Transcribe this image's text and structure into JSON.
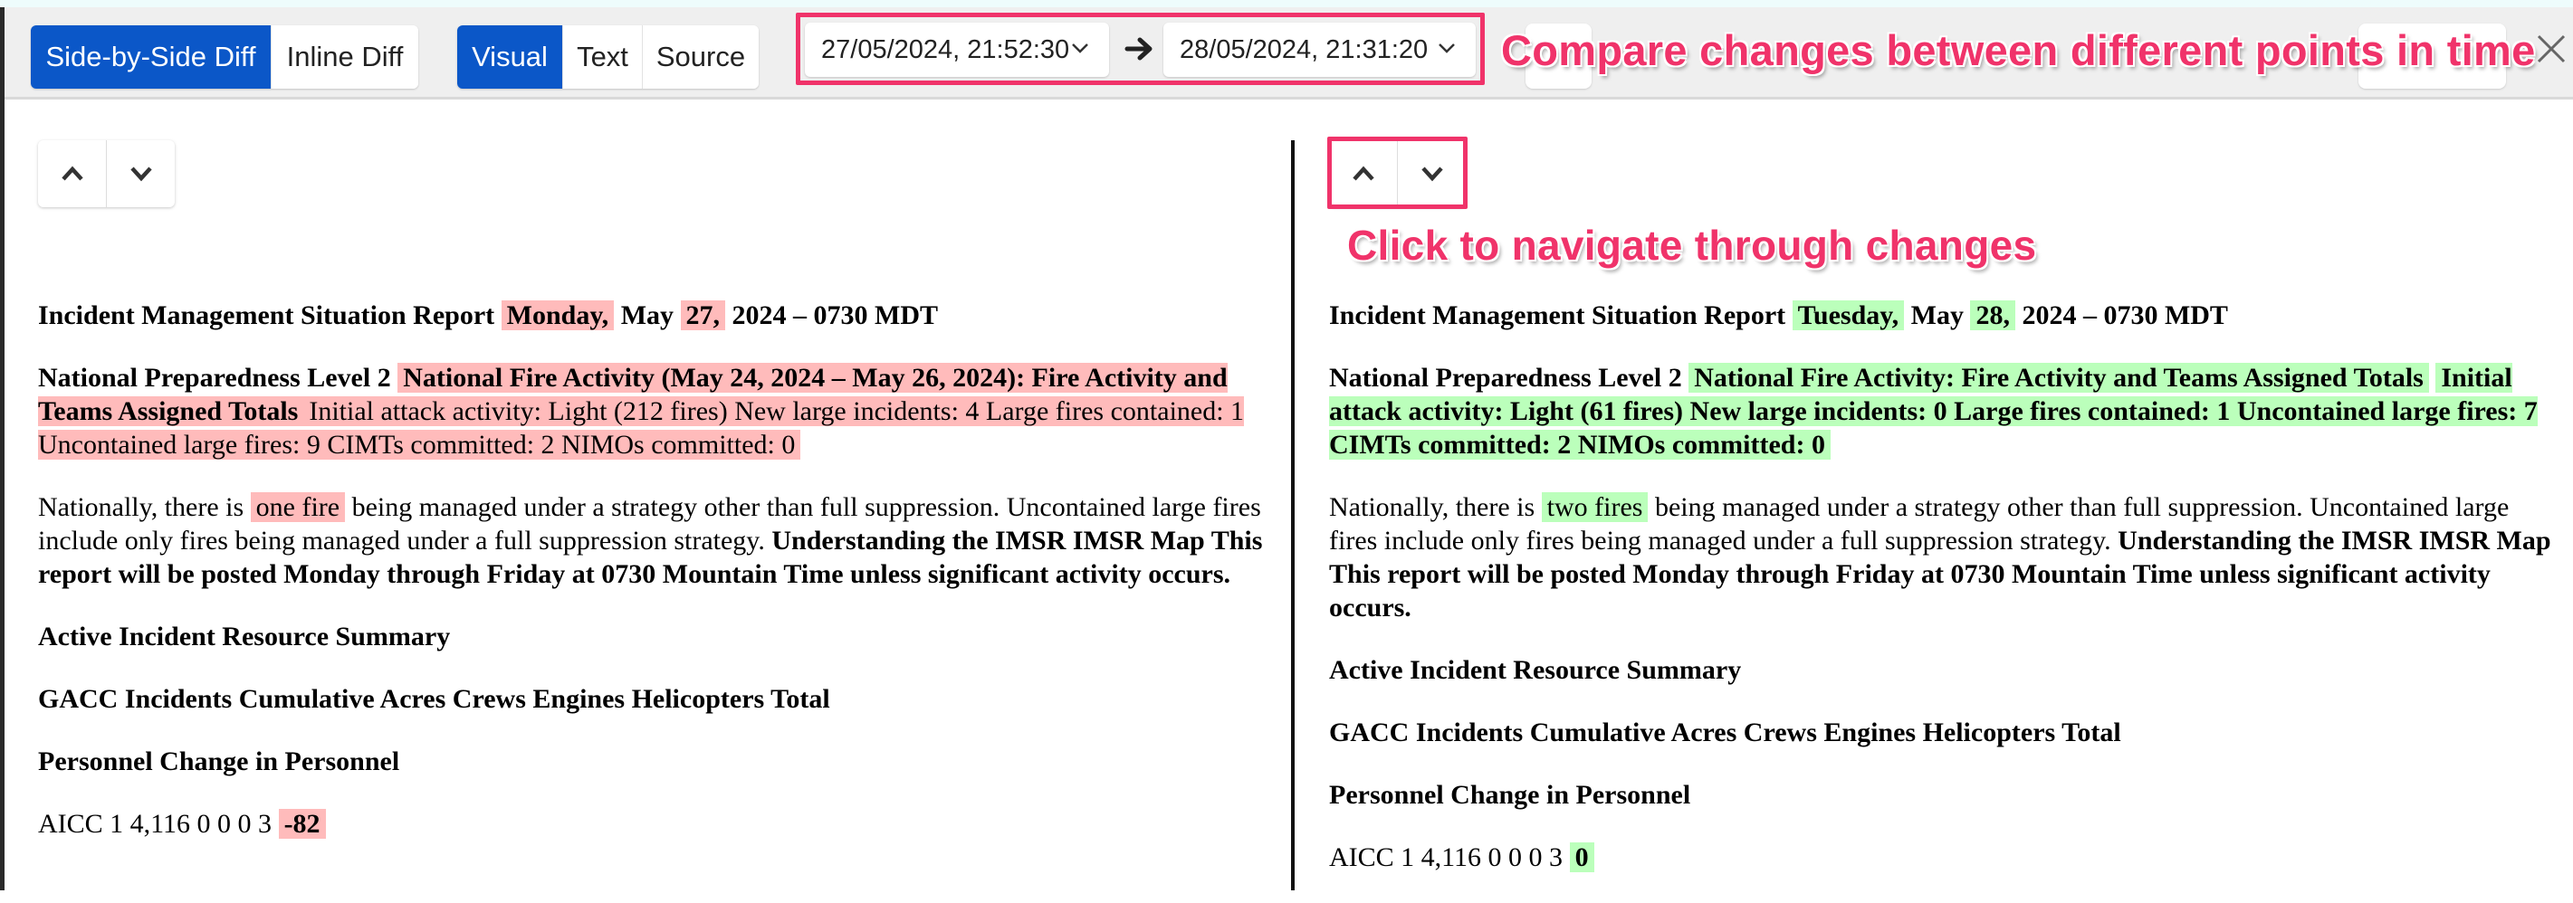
{
  "toolbar": {
    "view_modes": [
      {
        "label": "Side-by-Side Diff",
        "active": true
      },
      {
        "label": "Inline Diff",
        "active": false
      }
    ],
    "content_modes": [
      {
        "label": "Visual",
        "active": true
      },
      {
        "label": "Text",
        "active": false
      },
      {
        "label": "Source",
        "active": false
      }
    ],
    "from_date": "27/05/2024, 21:52:30",
    "to_date": "28/05/2024, 21:31:20"
  },
  "annotations": {
    "compare": "Compare changes between different points in time",
    "navigate": "Click to navigate through changes"
  },
  "colors": {
    "accent": "#0b57c8",
    "callout": "#f0336a",
    "deleted": "#ffbbbb",
    "inserted": "#bbffbb"
  },
  "left": {
    "title": {
      "pre": "Incident Management Situation Report",
      "day": "Monday,",
      "month": "May",
      "date": "27,",
      "post": "2024 – 0730 MDT"
    },
    "npl": {
      "pre": "National Preparedness Level 2",
      "changed_bold": "National Fire Activity (May 24, 2024 – May 26, 2024): Fire Activity and Teams Assigned Totals",
      "changed_text": "Initial attack activity: Light (212 fires) New large incidents: 4 Large fires contained: 1 Uncontained large fires: 9 CIMTs committed: 2 NIMOs committed: 0"
    },
    "nationally": {
      "pre": "Nationally, there is",
      "changed": "one fire",
      "post": "being managed under a strategy other than full suppression. Uncontained large fires include only fires being managed under a full suppression strategy.",
      "bold": "Understanding the IMSR IMSR Map This report will be posted Monday through Friday at 0730 Mountain Time unless significant activity occurs."
    },
    "resource_summary": "Active Incident Resource Summary",
    "table_header": "GACC Incidents Cumulative Acres Crews Engines Helicopters Total",
    "personnel_header": "Personnel Change in Personnel",
    "aicc_row": {
      "text": "AICC 1 4,116 0 0 0 3",
      "changed": "-82"
    }
  },
  "right": {
    "title": {
      "pre": "Incident Management Situation Report",
      "day": "Tuesday,",
      "month": "May",
      "date": "28,",
      "post": "2024 – 0730 MDT"
    },
    "npl": {
      "pre": "National Preparedness Level 2",
      "changed_bold": "National Fire Activity: Fire Activity and Teams Assigned Totals",
      "changed_text": "Initial attack activity: Light (61 fires) New large incidents: 0 Large fires contained: 1 Uncontained large fires: 7 CIMTs committed: 2 NIMOs committed: 0"
    },
    "nationally": {
      "pre": "Nationally, there is",
      "changed": "two fires",
      "post": "being managed under a strategy other than full suppression. Uncontained large fires include only fires being managed under a full suppression strategy.",
      "bold": "Understanding the IMSR IMSR Map This report will be posted Monday through Friday at 0730 Mountain Time unless significant activity occurs."
    },
    "resource_summary": "Active Incident Resource Summary",
    "table_header": "GACC Incidents Cumulative Acres Crews Engines Helicopters Total",
    "personnel_header": "Personnel Change in Personnel",
    "aicc_row": {
      "text": "AICC 1 4,116 0 0 0 3",
      "changed": "0"
    }
  }
}
